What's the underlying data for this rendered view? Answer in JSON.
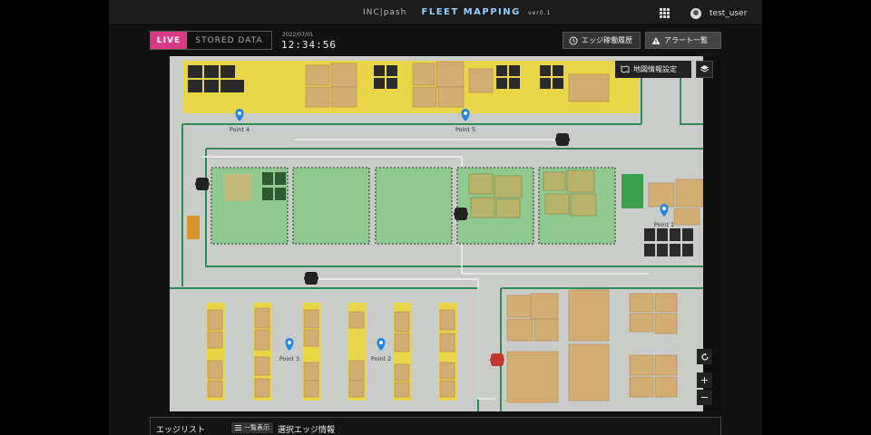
{
  "header": {
    "logo": "INC|pash",
    "app_title": "FLEET MAPPING",
    "version": "ver0.1",
    "username": "test_user"
  },
  "toolbar": {
    "live_label": "LIVE",
    "stored_label": "STORED DATA",
    "date": "2022/07/01",
    "time": "12:34:56",
    "history_label": "エッジ稼働履歴",
    "alert_label": "アラート一覧"
  },
  "map": {
    "settings_label": "地図情報設定",
    "points": [
      {
        "label": "Point 4"
      },
      {
        "label": "Point 5"
      },
      {
        "label": "Point 1"
      },
      {
        "label": "Point 3"
      },
      {
        "label": "Point 2"
      }
    ],
    "icons": {
      "reset": "rotate-icon",
      "zoom_in": "+",
      "zoom_out": "−",
      "layers": "layers-icon"
    },
    "colors": {
      "floor": "#c9ccc8",
      "shelf_yellow": "#e9d548",
      "zone_green": "#8fc98f",
      "pin_blue": "#1e88e5",
      "robot_alert": "#c0392b",
      "path": "#2e8b57"
    }
  },
  "bottom_panel": {
    "edge_list_label": "エッジリスト",
    "list_view_label": "一覧表示",
    "selected_edge_label": "選択エッジ情報"
  }
}
